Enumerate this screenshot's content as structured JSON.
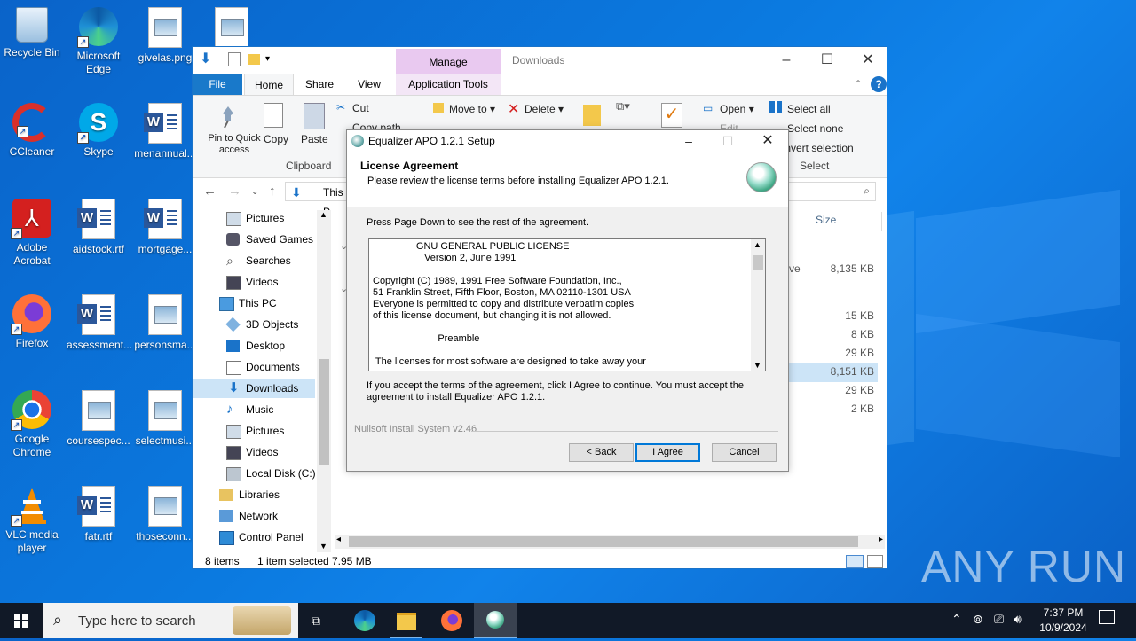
{
  "desktop": {
    "icons": [
      {
        "label": "Recycle Bin"
      },
      {
        "label": "Microsoft Edge"
      },
      {
        "label": "givelas.png"
      },
      {
        "label": "CCleaner"
      },
      {
        "label": "Skype"
      },
      {
        "label": "menannual..."
      },
      {
        "label": "Adobe Acrobat"
      },
      {
        "label": "aidstock.rtf"
      },
      {
        "label": "mortgage..."
      },
      {
        "label": "Firefox"
      },
      {
        "label": "assessment..."
      },
      {
        "label": "personsma..."
      },
      {
        "label": "Google Chrome"
      },
      {
        "label": "coursespec..."
      },
      {
        "label": "selectmusi..."
      },
      {
        "label": "VLC media player"
      },
      {
        "label": "fatr.rtf"
      },
      {
        "label": "thoseconn..."
      }
    ],
    "watermark": "ANY RUN"
  },
  "explorer": {
    "title": "Downloads",
    "manage_tab": "Manage",
    "tabs": {
      "file": "File",
      "home": "Home",
      "share": "Share",
      "view": "View",
      "app_tools": "Application Tools"
    },
    "ribbon": {
      "pin": "Pin to Quick access",
      "copy": "Copy",
      "paste": "Paste",
      "cut": "Cut",
      "copy_path": "Copy path",
      "clipboard": "Clipboard",
      "move_to": "Move to",
      "delete": "Delete",
      "open": "Open",
      "edit": "Edit",
      "select_all": "Select all",
      "select_none": "Select none",
      "invert_selection": "Invert selection",
      "select_group": "Select"
    },
    "address": "This P",
    "nav": [
      {
        "label": "Pictures",
        "icon": "pictures-icon"
      },
      {
        "label": "Saved Games",
        "icon": "saved-games-icon"
      },
      {
        "label": "Searches",
        "icon": "searches-icon"
      },
      {
        "label": "Videos",
        "icon": "videos-icon"
      },
      {
        "label": "This PC",
        "icon": "this-pc-icon"
      },
      {
        "label": "3D Objects",
        "icon": "3d-objects-icon"
      },
      {
        "label": "Desktop",
        "icon": "desktop-icon"
      },
      {
        "label": "Documents",
        "icon": "documents-icon"
      },
      {
        "label": "Downloads",
        "icon": "downloads-icon"
      },
      {
        "label": "Music",
        "icon": "music-icon"
      },
      {
        "label": "Pictures",
        "icon": "pictures-icon"
      },
      {
        "label": "Videos",
        "icon": "videos-icon"
      },
      {
        "label": "Local Disk (C:)",
        "icon": "disk-icon"
      },
      {
        "label": "Libraries",
        "icon": "libraries-icon"
      },
      {
        "label": "Network",
        "icon": "network-icon"
      },
      {
        "label": "Control Panel",
        "icon": "control-panel-icon"
      }
    ],
    "size_header": "Size",
    "partial_text": "ve",
    "sizes": [
      "8,135 KB",
      "15 KB",
      "8 KB",
      "29 KB",
      "8,151 KB",
      "29 KB",
      "2 KB"
    ],
    "status": {
      "count": "8 items",
      "selected": "1 item selected",
      "size": "7.95 MB"
    }
  },
  "installer": {
    "title": "Equalizer APO 1.2.1 Setup",
    "heading": "License Agreement",
    "subheading": "Please review the license terms before installing Equalizer APO 1.2.1.",
    "prompt": "Press Page Down to see the rest of the agreement.",
    "license_text": "                GNU GENERAL PUBLIC LICENSE\n                   Version 2, June 1991\n\nCopyright (C) 1989, 1991 Free Software Foundation, Inc.,\n51 Franklin Street, Fifth Floor, Boston, MA 02110-1301 USA\nEveryone is permitted to copy and distribute verbatim copies\nof this license document, but changing it is not allowed.\n\n                        Preamble\n\n The licenses for most software are designed to take away your",
    "accept_text": "If you accept the terms of the agreement, click I Agree to continue. You must accept the agreement to install Equalizer APO 1.2.1.",
    "nsis": "Nullsoft Install System v2.46",
    "buttons": {
      "back": "< Back",
      "agree": "I Agree",
      "cancel": "Cancel"
    }
  },
  "taskbar": {
    "search_placeholder": "Type here to search",
    "time": "7:37 PM",
    "date": "10/9/2024"
  }
}
